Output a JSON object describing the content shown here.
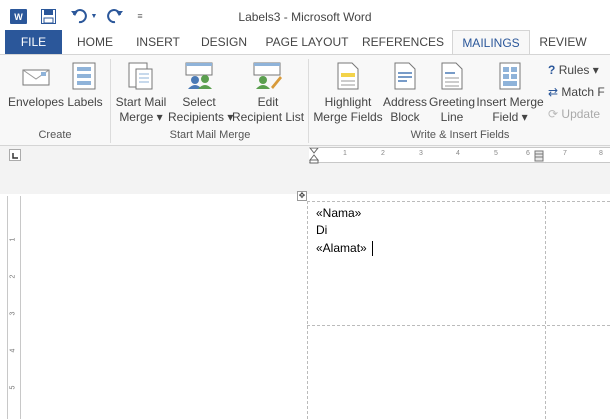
{
  "window": {
    "title": "Labels3 - Microsoft Word",
    "app_icon_letter": "W"
  },
  "tabs": [
    {
      "label": "FILE"
    },
    {
      "label": "HOME"
    },
    {
      "label": "INSERT"
    },
    {
      "label": "DESIGN"
    },
    {
      "label": "PAGE LAYOUT"
    },
    {
      "label": "REFERENCES"
    },
    {
      "label": "MAILINGS",
      "active": true
    },
    {
      "label": "REVIEW"
    }
  ],
  "ribbon": {
    "create": {
      "label": "Create",
      "envelopes": "Envelopes",
      "labels": "Labels"
    },
    "start_mail_merge": {
      "label": "Start Mail Merge",
      "start_line1": "Start Mail",
      "start_line2": "Merge ▾",
      "select_line1": "Select",
      "select_line2": "Recipients ▾",
      "edit_line1": "Edit",
      "edit_line2": "Recipient List"
    },
    "write_insert": {
      "label": "Write & Insert Fields",
      "highlight_line1": "Highlight",
      "highlight_line2": "Merge Fields",
      "address_line1": "Address",
      "address_line2": "Block",
      "greeting_line1": "Greeting",
      "greeting_line2": "Line",
      "insert_line1": "Insert Merge",
      "insert_line2": "Field ▾",
      "rules": "Rules ▾",
      "match": "Match F",
      "update": "Update"
    }
  },
  "ruler": {
    "ticks": [
      "1",
      "2",
      "3",
      "4",
      "5",
      "6",
      "7",
      "8"
    ],
    "v_ticks": [
      "1",
      "2",
      "3",
      "4",
      "5"
    ]
  },
  "document": {
    "lines": [
      "«Nama»",
      "Di",
      "«Alamat»"
    ]
  },
  "colors": {
    "accent": "#2b579a",
    "ribbon_bg": "#f8f8f8"
  }
}
